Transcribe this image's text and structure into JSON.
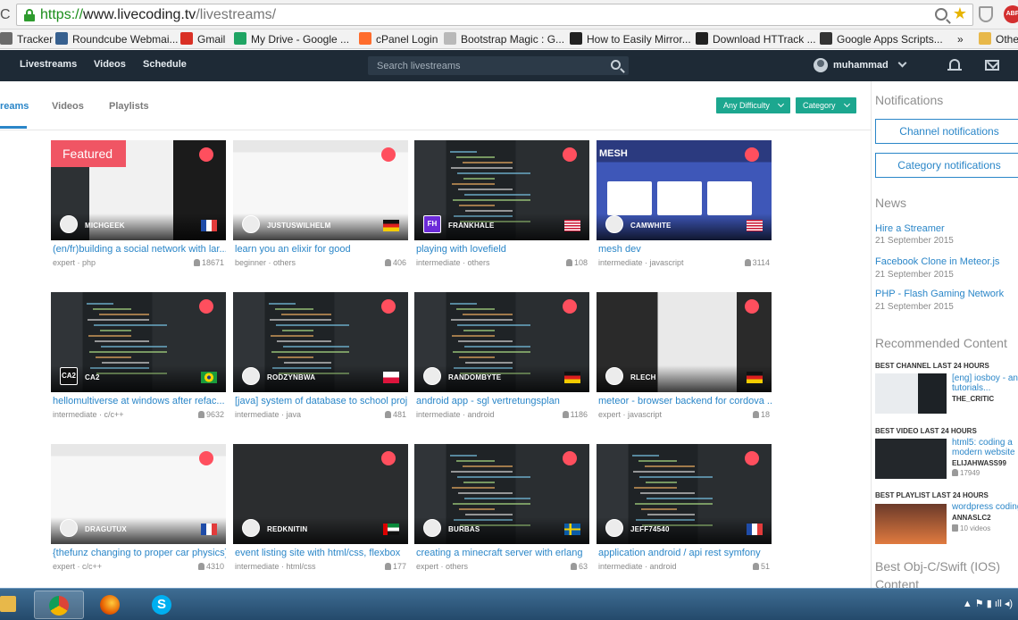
{
  "browser": {
    "url_scheme": "https://",
    "url_host": "www.livecoding.tv",
    "url_path": "/livestreams/",
    "bookmarks": [
      {
        "label": "Tracker",
        "icon": "tracker-icon",
        "color": "#6b6b6b"
      },
      {
        "label": "Roundcube Webmai...",
        "icon": "roundcube-icon",
        "color": "#37608f"
      },
      {
        "label": "Gmail",
        "icon": "gmail-icon",
        "color": "#d93025"
      },
      {
        "label": "My Drive - Google ...",
        "icon": "drive-icon",
        "color": "#1fa463"
      },
      {
        "label": "cPanel Login",
        "icon": "cpanel-icon",
        "color": "#ff6c2c"
      },
      {
        "label": "Bootstrap Magic : G...",
        "icon": "document-icon",
        "color": "#b9b9b9"
      },
      {
        "label": "How to Easily Mirror...",
        "icon": "x-icon",
        "color": "#222222"
      },
      {
        "label": "Download HTTrack ...",
        "icon": "httrack-icon",
        "color": "#222222"
      },
      {
        "label": "Google Apps Scripts...",
        "icon": "dj-icon",
        "color": "#333333"
      },
      {
        "label": "»",
        "icon": "more-icon",
        "color": "#555555"
      },
      {
        "label": "Othe",
        "icon": "folder-icon",
        "color": "#e8b84a"
      }
    ]
  },
  "nav": {
    "links": [
      "Livestreams",
      "Videos",
      "Schedule"
    ],
    "search_placeholder": "Search livestreams",
    "user": "muhammad"
  },
  "subnav": {
    "tabs": [
      "reams",
      "Videos",
      "Playlists"
    ],
    "filters": [
      "Any Difficulty",
      "Category"
    ]
  },
  "featured_label": "Featured",
  "streams": [
    {
      "user": "MICHGEEK",
      "title": "(en/fr)building a social network with lar...",
      "level": "expert",
      "category": "php",
      "viewers": "18671",
      "flag": "fr",
      "scene": "desktop"
    },
    {
      "user": "JUSTUSWILHELM",
      "title": "learn you an elixir for good",
      "level": "beginner",
      "category": "others",
      "viewers": "406",
      "flag": "de",
      "scene": "light"
    },
    {
      "user": "FRANKHALE",
      "title": "playing with lovefield",
      "level": "intermediate",
      "category": "others",
      "viewers": "108",
      "flag": "us",
      "scene": "code",
      "avatar_text": "FH"
    },
    {
      "user": "CAMWHITE",
      "title": "mesh dev",
      "level": "intermediate",
      "category": "javascript",
      "viewers": "3114",
      "flag": "us",
      "scene": "mesh",
      "mesh_label": "MESH"
    },
    {
      "user": "CA2",
      "title": "hellomultiverse at windows after refac...",
      "level": "intermediate",
      "category": "c/c++",
      "viewers": "9632",
      "flag": "br",
      "scene": "code",
      "avatar_text": "CA2"
    },
    {
      "user": "RODZYNBWA",
      "title": "[java] system of database to school proj...",
      "level": "intermediate",
      "category": "java",
      "viewers": "481",
      "flag": "pl",
      "scene": "code"
    },
    {
      "user": "RANDOMBYTE",
      "title": "android app - sgl vertretungsplan",
      "level": "intermediate",
      "category": "android",
      "viewers": "1186",
      "flag": "de",
      "scene": "code"
    },
    {
      "user": "RLECH",
      "title": "meteor - browser backend for cordova ...",
      "level": "expert",
      "category": "javascript",
      "viewers": "18",
      "flag": "de",
      "scene": "dark"
    },
    {
      "user": "DRAGUTUX",
      "title": "{thefunz changing to proper car physics}",
      "level": "expert",
      "category": "c/c++",
      "viewers": "4310",
      "flag": "fr",
      "scene": "light"
    },
    {
      "user": "REDKNITIN",
      "title": "event listing site with html/css, flexbox",
      "level": "intermediate",
      "category": "html/css",
      "viewers": "177",
      "flag": "ae",
      "scene": "blank"
    },
    {
      "user": "BURBAS",
      "title": "creating a minecraft server with erlang",
      "level": "expert",
      "category": "others",
      "viewers": "63",
      "flag": "se",
      "scene": "code"
    },
    {
      "user": "JEFF74540",
      "title": "application android / api rest symfony",
      "level": "intermediate",
      "category": "android",
      "viewers": "51",
      "flag": "fr",
      "scene": "code"
    }
  ],
  "sidebar": {
    "notifications_heading": "Notifications",
    "channel_btn": "Channel notifications",
    "category_btn": "Category notifications",
    "news_heading": "News",
    "news": [
      {
        "title": "Hire a Streamer",
        "date": "21 September 2015"
      },
      {
        "title": "Facebook Clone in Meteor.js",
        "date": "21 September 2015"
      },
      {
        "title": "PHP - Flash Gaming Network",
        "date": "21 September 2015"
      }
    ],
    "recommended_heading": "Recommended Content",
    "recommended": [
      {
        "label": "BEST CHANNEL LAST 24 HOURS",
        "title": "[eng] iosboy - an i tutorials...",
        "user": "THE_CRITIC",
        "meta": ""
      },
      {
        "label": "BEST VIDEO LAST 24 HOURS",
        "title": "html5: coding a modern website",
        "user": "ELIJAHWASS99",
        "meta": "17949"
      },
      {
        "label": "BEST PLAYLIST LAST 24 HOURS",
        "title": "wordpress coding",
        "user": "ANNASLC2",
        "meta": "10 videos"
      }
    ],
    "bottom_heading": "Best Obj-C/Swift (IOS) Content"
  },
  "colors": {
    "accent": "#2a86c8",
    "filter": "#1ca78f",
    "live": "#ff4f5e",
    "featured": "#f05564",
    "nav": "#1e2a36"
  }
}
